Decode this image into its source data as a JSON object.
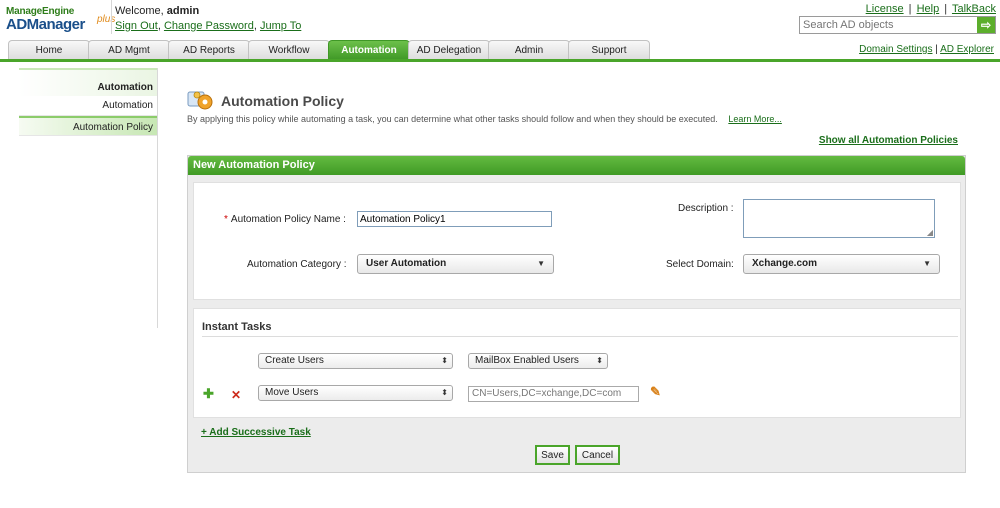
{
  "header": {
    "logo_line1": "ManageEngine",
    "logo_line2": "ADManager",
    "logo_sup": "plus",
    "welcome_label": "Welcome,",
    "username": "admin",
    "sign_out": "Sign Out",
    "change_password": "Change Password",
    "jump_to": "Jump To",
    "link_sep": ",",
    "license": "License",
    "help": "Help",
    "talkback": "TalkBack",
    "sep": "|",
    "search_placeholder": "Search AD objects",
    "search_button": "⇨"
  },
  "tabs": [
    {
      "label": "Home"
    },
    {
      "label": "AD Mgmt"
    },
    {
      "label": "AD Reports"
    },
    {
      "label": "Workflow"
    },
    {
      "label": "Automation"
    },
    {
      "label": "AD Delegation"
    },
    {
      "label": "Admin"
    },
    {
      "label": "Support"
    }
  ],
  "active_tab": "Automation",
  "right_links": {
    "domain_settings": "Domain Settings",
    "ad_explorer": "AD Explorer",
    "sep": "|"
  },
  "sidebar": {
    "heading": "Automation",
    "items": [
      {
        "label": "Automation"
      },
      {
        "label": "Automation Policy"
      }
    ]
  },
  "page": {
    "title": "Automation Policy",
    "description": "By applying this policy while automating a task, you can determine what other tasks should follow and when they should be executed.",
    "learn_more": "Learn More...",
    "show_all": "Show all Automation Policies"
  },
  "form": {
    "panel_title": "New Automation Policy",
    "name_label": "Automation Policy Name :",
    "required_mark": "*",
    "name_value": "Automation Policy1",
    "description_label": "Description :",
    "description_value": "",
    "category_label": "Automation Category :",
    "category_value": "User Automation",
    "domain_label": "Select Domain:",
    "domain_value": "Xchange.com",
    "dropdown_arrow": "▼"
  },
  "instant_tasks": {
    "title": "Instant Tasks",
    "rows": [
      {
        "task": "Create Users",
        "option": "MailBox Enabled Users"
      },
      {
        "task": "Move Users",
        "target": "CN=Users,DC=xchange,DC=com"
      }
    ],
    "add_icon": "✚",
    "remove_icon": "✕",
    "edit_icon": "✎",
    "select_arrow": "⬍",
    "add_successive": "+ Add Successive Task"
  },
  "buttons": {
    "save": "Save",
    "cancel": "Cancel"
  },
  "colors": {
    "brand_green": "#4aa52a",
    "link_green": "#1a6e1a",
    "required_red": "#cc0000"
  }
}
